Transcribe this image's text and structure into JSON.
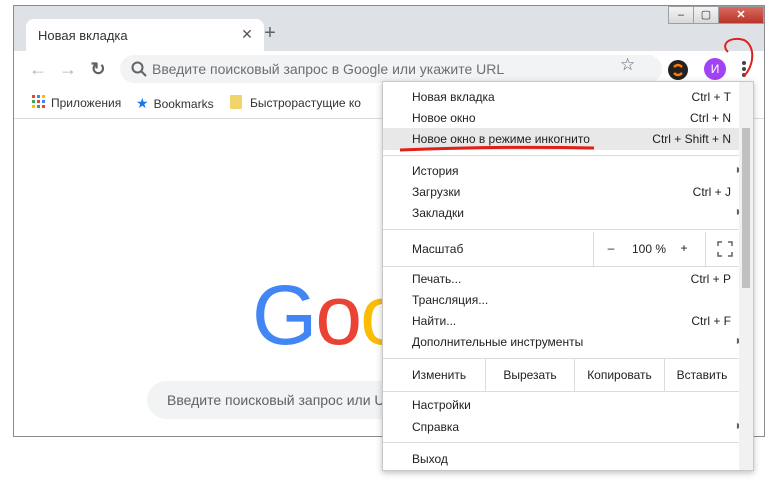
{
  "tab": {
    "title": "Новая вкладка",
    "close_icon": "✕"
  },
  "window_controls": {
    "minimize": "‒",
    "maximize": "▢",
    "close": "✕"
  },
  "toolbar": {
    "back": "←",
    "forward": "→",
    "reload": "↻",
    "omnibox_placeholder": "Введите поисковый запрос в Google или укажите URL",
    "star": "☆",
    "avatar_letter": "И"
  },
  "bookmarks": [
    {
      "label": "Приложения"
    },
    {
      "label": "Bookmarks"
    },
    {
      "label": "Быстрорастущие ко"
    }
  ],
  "content": {
    "search_placeholder": "Введите поисковый запрос или URL"
  },
  "menu": {
    "new_tab": {
      "label": "Новая вкладка",
      "shortcut": "Ctrl + T"
    },
    "new_window": {
      "label": "Новое окно",
      "shortcut": "Ctrl + N"
    },
    "incognito": {
      "label": "Новое окно в режиме инкогнито",
      "shortcut": "Ctrl + Shift + N"
    },
    "history": {
      "label": "История"
    },
    "downloads": {
      "label": "Загрузки",
      "shortcut": "Ctrl + J"
    },
    "bookmarks": {
      "label": "Закладки"
    },
    "zoom": {
      "label": "Масштаб",
      "minus": "–",
      "value": "100 %",
      "plus": "+"
    },
    "print": {
      "label": "Печать...",
      "shortcut": "Ctrl + P"
    },
    "cast": {
      "label": "Трансляция..."
    },
    "find": {
      "label": "Найти...",
      "shortcut": "Ctrl + F"
    },
    "more_tools": {
      "label": "Дополнительные инструменты"
    },
    "edit": {
      "label": "Изменить",
      "cut": "Вырезать",
      "copy": "Копировать",
      "paste": "Вставить"
    },
    "settings": {
      "label": "Настройки"
    },
    "help": {
      "label": "Справка"
    },
    "exit": {
      "label": "Выход"
    }
  },
  "colors": {
    "google_blue": "#4285f4",
    "google_red": "#ea4335",
    "google_yellow": "#fbbc05",
    "annotation_red": "#e0201a",
    "avatar": "#a142f4"
  }
}
